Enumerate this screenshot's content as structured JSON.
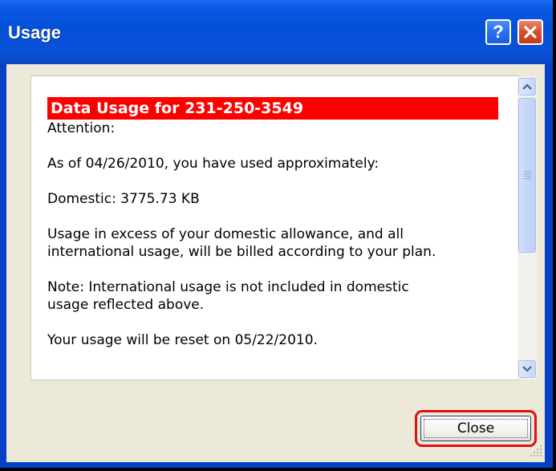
{
  "window": {
    "title": "Usage",
    "help_glyph": "?",
    "close_icon": "close-icon"
  },
  "content": {
    "header": "Data Usage for 231-250-3549",
    "attention": "Attention:",
    "as_of": "As of 04/26/2010, you have used approximately:",
    "domestic": "Domestic: 3775.73 KB",
    "excess_line1": "Usage in excess of your domestic allowance, and all",
    "excess_line2": "international usage, will be billed according to your plan.",
    "note_line1": "Note: International usage is not included in domestic",
    "note_line2": "usage reflected above.",
    "reset": "Your usage will be reset on 05/22/2010."
  },
  "buttons": {
    "close_label": "Close"
  },
  "colors": {
    "titlebar": "#0a52d8",
    "header_bg": "#ff0000",
    "highlight": "#e01010",
    "client_bg": "#ece9d8"
  }
}
